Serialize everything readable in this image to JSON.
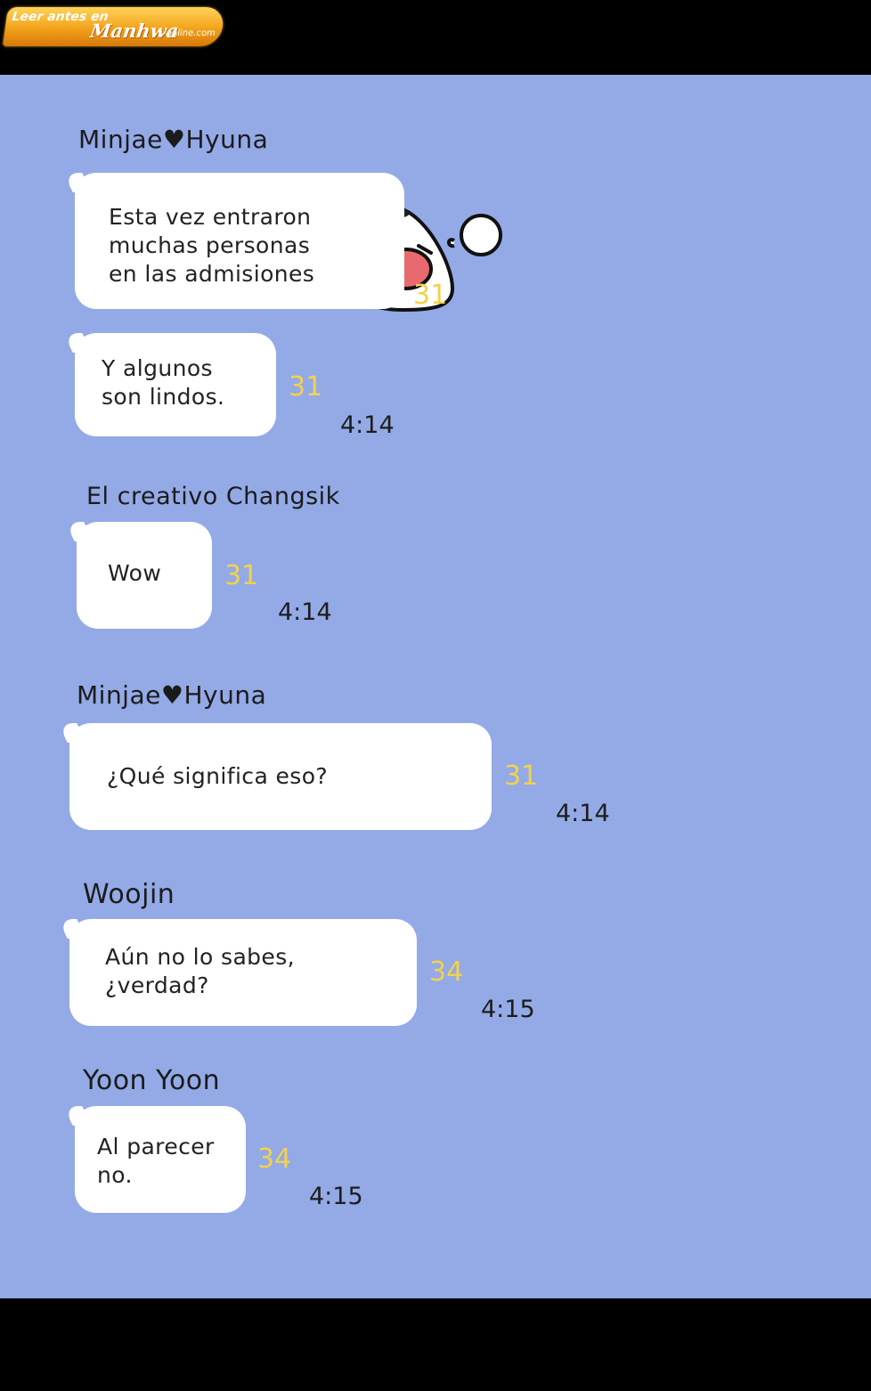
{
  "watermark": {
    "line1": "Leer antes en",
    "brand": "Manhwa",
    "domain": "-online.com"
  },
  "colors": {
    "background": "#93aae6",
    "bubble": "#ffffff",
    "unread_count": "#f2d24c",
    "bars": "#000000"
  },
  "sticker": {
    "icon": "crying-onigiri-sticker"
  },
  "messages": [
    {
      "sender": "Minjae♥Hyuna",
      "bubbles": [
        {
          "text": "Esta vez entraron\nmuchas personas\nen las admisiones",
          "count": "31",
          "time": ""
        },
        {
          "text": "Y algunos\nson lindos.",
          "count": "31",
          "time": "4:14"
        }
      ]
    },
    {
      "sender": "El creativo Changsik",
      "bubbles": [
        {
          "text": "Wow",
          "count": "31",
          "time": "4:14"
        }
      ]
    },
    {
      "sender": "Minjae♥Hyuna",
      "bubbles": [
        {
          "text": "¿Qué significa eso?",
          "count": "31",
          "time": "4:14"
        }
      ]
    },
    {
      "sender": "Woojin",
      "bubbles": [
        {
          "text": "Aún no lo sabes,\n¿verdad?",
          "count": "34",
          "time": "4:15"
        }
      ]
    },
    {
      "sender": "Yoon Yoon",
      "bubbles": [
        {
          "text": "Al parecer\nno.",
          "count": "34",
          "time": "4:15"
        }
      ]
    }
  ]
}
